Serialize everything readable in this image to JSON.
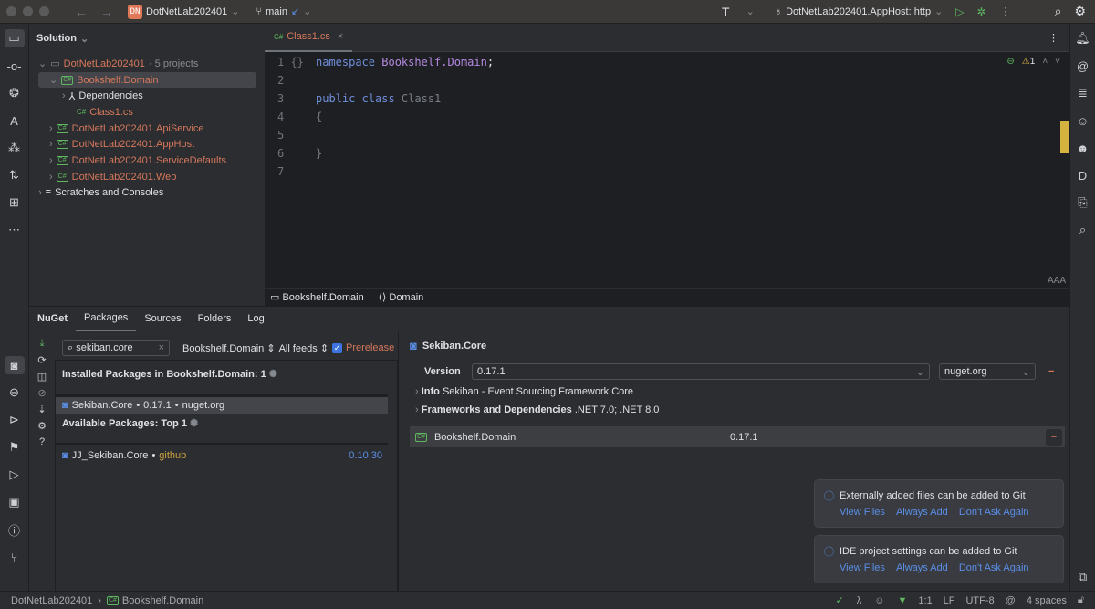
{
  "titlebar": {
    "project_initials": "DN",
    "project": "DotNetLab202401",
    "branch": "main",
    "run_config": "DotNetLab202401.AppHost: http"
  },
  "solution": {
    "header": "Solution",
    "root": {
      "name": "DotNetLab202401",
      "meta": "· 5 projects"
    },
    "items": [
      {
        "label": "Bookshelf.Domain",
        "type": "project",
        "level": 1,
        "expanded": true,
        "selected": true
      },
      {
        "label": "Dependencies",
        "type": "deps",
        "level": 2
      },
      {
        "label": "Class1.cs",
        "type": "file",
        "level": 2
      },
      {
        "label": "DotNetLab202401.ApiService",
        "type": "project",
        "level": 1
      },
      {
        "label": "DotNetLab202401.AppHost",
        "type": "project",
        "level": 1
      },
      {
        "label": "DotNetLab202401.ServiceDefaults",
        "type": "project",
        "level": 1
      },
      {
        "label": "DotNetLab202401.Web",
        "type": "project",
        "level": 1
      }
    ],
    "scratches": "Scratches and Consoles"
  },
  "editor": {
    "tab": "Class1.cs",
    "tab_badge": "C#",
    "warnings": "1",
    "lines": [
      [
        {
          "t": "namespace ",
          "c": "kw"
        },
        {
          "t": "Bookshelf.Domain",
          "c": "ns"
        },
        {
          "t": ";",
          "c": ""
        }
      ],
      [],
      [
        {
          "t": "public class ",
          "c": "kw"
        },
        {
          "t": "Class1",
          "c": "gray"
        }
      ],
      [
        {
          "t": "{",
          "c": "gray"
        }
      ],
      [],
      [
        {
          "t": "}",
          "c": "gray"
        }
      ],
      []
    ],
    "breadcrumb": [
      "Bookshelf.Domain",
      "Domain"
    ]
  },
  "nuget": {
    "title": "NuGet",
    "tabs": [
      "Packages",
      "Sources",
      "Folders",
      "Log"
    ],
    "search_value": "sekiban.core",
    "project_filter": "Bookshelf.Domain",
    "feed_filter": "All feeds",
    "prerelease_label": "Prerelease",
    "prerelease_checked": true,
    "installed_header": "Installed Packages in Bookshelf.Domain: 1",
    "installed": [
      {
        "name": "Sekiban.Core",
        "version": "0.17.1",
        "source": "nuget.org"
      }
    ],
    "available_header": "Available Packages: Top 1",
    "available": [
      {
        "name": "JJ_Sekiban.Core",
        "source": "github",
        "version": "0.10.30"
      }
    ],
    "details": {
      "name": "Sekiban.Core",
      "version_label": "Version",
      "version": "0.17.1",
      "source": "nuget.org",
      "info_label": "Info",
      "info": "Sekiban - Event Sourcing Framework Core",
      "fw_label": "Frameworks and Dependencies",
      "fw": ".NET 7.0; .NET 8.0",
      "projects": [
        {
          "name": "Bookshelf.Domain",
          "version": "0.17.1"
        }
      ]
    }
  },
  "notifications": [
    {
      "text": "Externally added files can be added to Git",
      "actions": [
        "View Files",
        "Always Add",
        "Don't Ask Again"
      ]
    },
    {
      "text": "IDE project settings can be added to Git",
      "actions": [
        "View Files",
        "Always Add",
        "Don't Ask Again"
      ]
    }
  ],
  "status": {
    "crumbs": [
      "DotNetLab202401",
      "Bookshelf.Domain"
    ],
    "position": "1:1",
    "line_sep": "LF",
    "encoding": "UTF-8",
    "indent": "4 spaces"
  }
}
